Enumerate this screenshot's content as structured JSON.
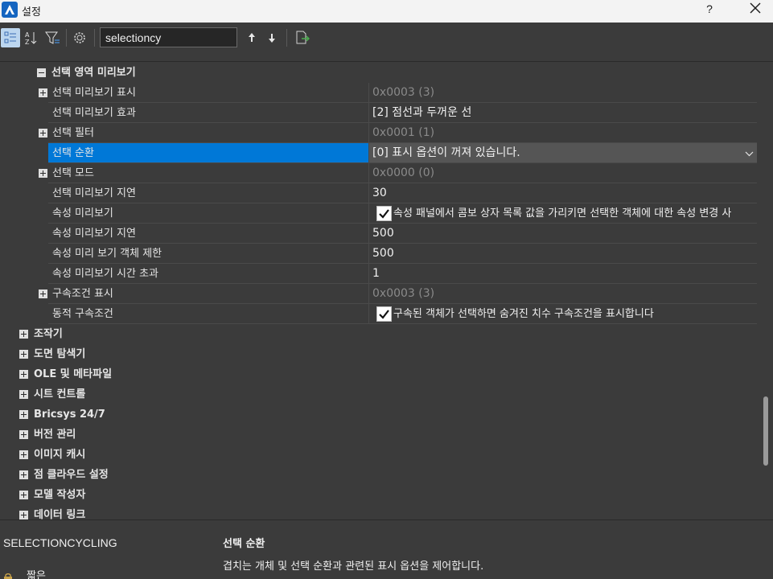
{
  "window": {
    "title": "설정",
    "help_label": "?",
    "icons": {
      "app": "bricscad-app-icon",
      "close": "close-icon"
    }
  },
  "toolbar": {
    "search_value": "selectioncy",
    "buttons": [
      "categorized-view-icon",
      "alphabetical-sort-icon",
      "filter-icon",
      "gear-icon",
      "arrow-up-icon",
      "arrow-down-icon",
      "export-icon"
    ]
  },
  "grid": {
    "rows": [
      {
        "type": "category",
        "level": 1,
        "expanded": true,
        "label": "선택 영역 미리보기"
      },
      {
        "type": "prop",
        "expandable": true,
        "label": "선택 미리보기 표시",
        "value": "0x0003 (3)",
        "dim": true
      },
      {
        "type": "prop",
        "expandable": false,
        "label": "선택 미리보기 효과",
        "value": "[2] 점선과 두꺼운 선",
        "dim": false
      },
      {
        "type": "prop",
        "expandable": true,
        "label": "선택 필터",
        "value": "0x0001 (1)",
        "dim": true
      },
      {
        "type": "prop",
        "expandable": false,
        "label": "선택 순환",
        "value": "[0] 표시 옵션이 꺼져 있습니다.",
        "dim": false,
        "selected": true
      },
      {
        "type": "prop",
        "expandable": true,
        "label": "선택 모드",
        "value": "0x0000 (0)",
        "dim": true
      },
      {
        "type": "prop",
        "expandable": false,
        "label": "선택 미리보기 지연",
        "value": "30",
        "dim": false
      },
      {
        "type": "prop",
        "expandable": false,
        "label": "속성 미리보기",
        "value": "속성 패널에서 콤보 상자 목록 값을 가리키면 선택한 객체에 대한 속성 변경 사",
        "checkbox": true,
        "checked": true
      },
      {
        "type": "prop",
        "expandable": false,
        "label": "속성 미리보기 지연",
        "value": "500",
        "dim": false
      },
      {
        "type": "prop",
        "expandable": false,
        "label": "속성 미리 보기 객체 제한",
        "value": "500",
        "dim": false
      },
      {
        "type": "prop",
        "expandable": false,
        "label": "속성 미리보기 시간 초과",
        "value": "1",
        "dim": false
      },
      {
        "type": "prop",
        "expandable": true,
        "label": "구속조건 표시",
        "value": "0x0003 (3)",
        "dim": true
      },
      {
        "type": "prop",
        "expandable": false,
        "label": "동적 구속조건",
        "value": "구속된 객체가 선택하면 숨겨진 치수 구속조건을 표시합니다",
        "checkbox": true,
        "checked": true
      },
      {
        "type": "category",
        "level": 0,
        "expanded": false,
        "label": "조작기"
      },
      {
        "type": "category",
        "level": 0,
        "expanded": false,
        "label": "도면 탐색기"
      },
      {
        "type": "category",
        "level": 0,
        "expanded": false,
        "label": "OLE 및 메타파일"
      },
      {
        "type": "category",
        "level": 0,
        "expanded": false,
        "label": "시트 컨트롤"
      },
      {
        "type": "category",
        "level": 0,
        "expanded": false,
        "label": "Bricsys 24/7"
      },
      {
        "type": "category",
        "level": 0,
        "expanded": false,
        "label": "버전 관리"
      },
      {
        "type": "category",
        "level": 0,
        "expanded": false,
        "label": "이미지 캐시"
      },
      {
        "type": "category",
        "level": 0,
        "expanded": false,
        "label": "점 클라우드 설정"
      },
      {
        "type": "category",
        "level": 0,
        "expanded": false,
        "label": "모델 작성자"
      },
      {
        "type": "category",
        "level": 0,
        "expanded": false,
        "label": "데이터 링크"
      }
    ]
  },
  "description": {
    "variable": "SELECTIONCYCLING",
    "title": "선택 순환",
    "text": "겹치는 개체 및 선택 순환과 관련된 표시 옵션을 제어합니다.",
    "short_label": "짧은",
    "short_icon": "lock-icon"
  },
  "colors": {
    "background": "#3b3b3b",
    "selection": "#0078d7",
    "titlebar": "#f3f3f3"
  }
}
